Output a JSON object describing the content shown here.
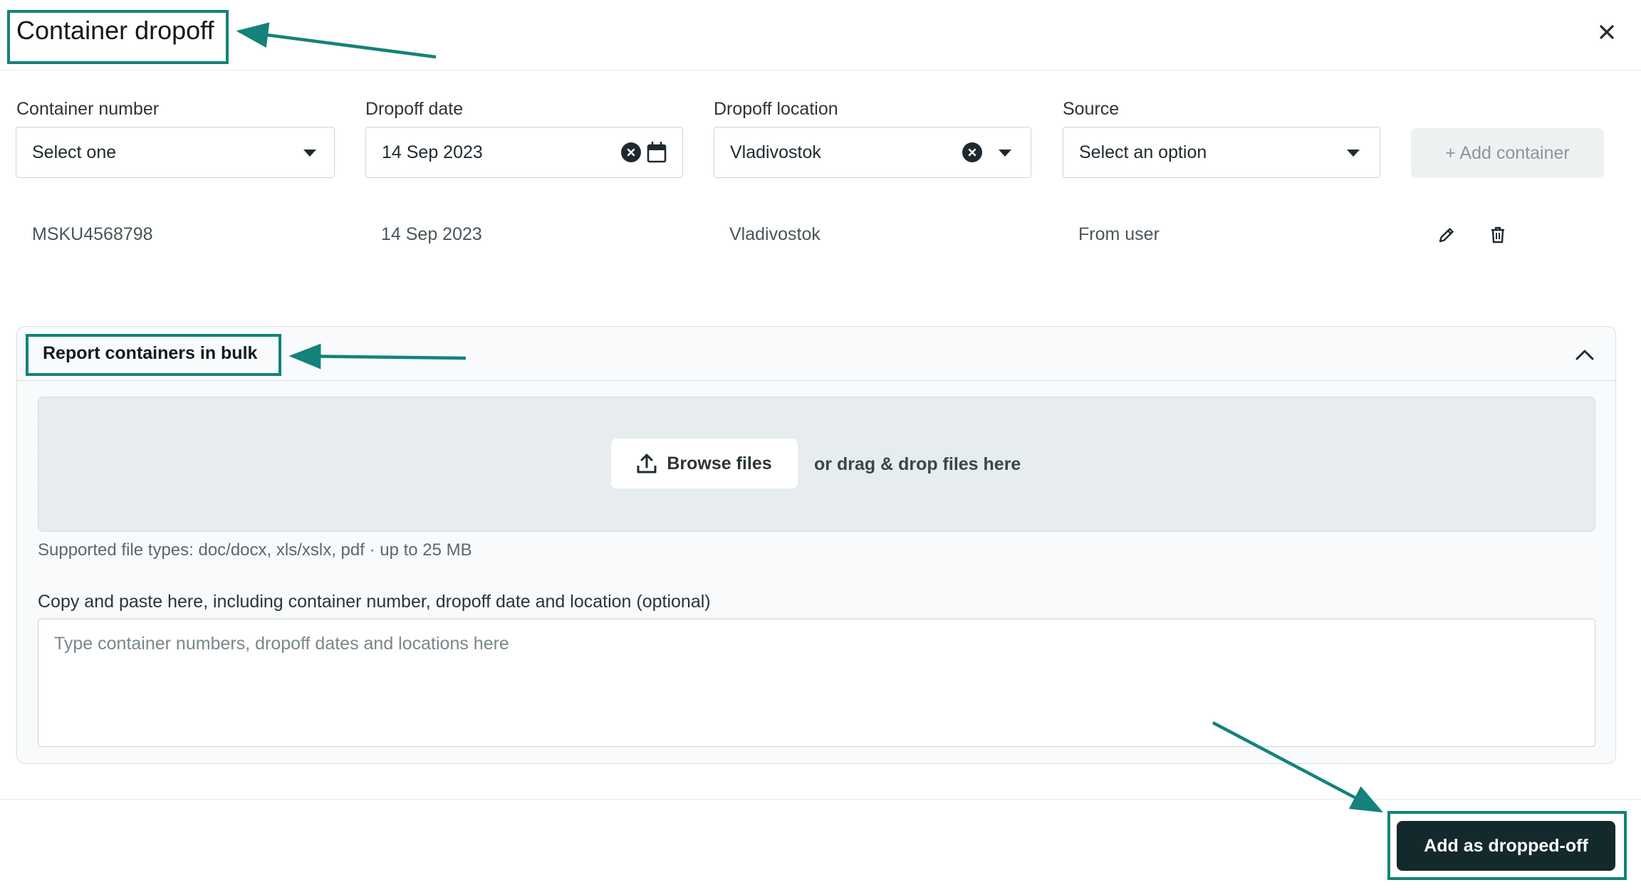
{
  "dialog": {
    "title": "Container dropoff",
    "close_icon": "close-icon"
  },
  "form": {
    "container_number": {
      "label": "Container number",
      "value": "Select one"
    },
    "dropoff_date": {
      "label": "Dropoff date",
      "value": "14 Sep 2023"
    },
    "dropoff_location": {
      "label": "Dropoff location",
      "value": "Vladivostok"
    },
    "source": {
      "label": "Source",
      "value": "Select an option"
    },
    "add_container_label": "+ Add container"
  },
  "containers": [
    {
      "number": "MSKU4568798",
      "date": "14 Sep 2023",
      "location": "Vladivostok",
      "source": "From user"
    }
  ],
  "bulk": {
    "title": "Report containers in bulk",
    "browse_label": "Browse files",
    "drag_text": "or drag & drop files here",
    "supported_text": "Supported file types: doc/docx, xls/xslx, pdf · up to 25 MB",
    "paste_label": "Copy and paste here, including container number, dropoff date and location (optional)",
    "paste_placeholder": "Type container numbers, dropoff dates and locations here"
  },
  "footer": {
    "submit_label": "Add as dropped-off"
  },
  "colors": {
    "primary_button": "#14292b",
    "annotation": "#14827a",
    "disabled_button": "#eef1f2"
  }
}
